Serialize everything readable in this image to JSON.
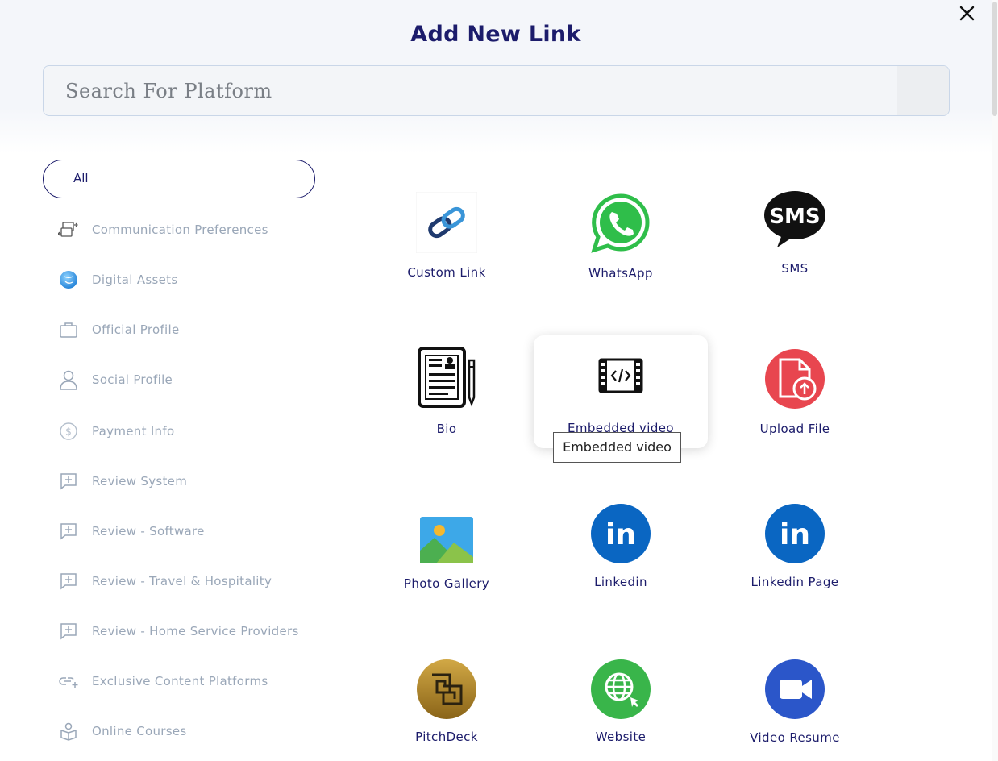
{
  "dialog": {
    "title": "Add New Link",
    "close_label": "close"
  },
  "search": {
    "placeholder": "Search For Platform",
    "value": ""
  },
  "categories": {
    "selected": "All",
    "items": [
      {
        "label": "Communication Preferences",
        "icon": "arrows-exchange-icon"
      },
      {
        "label": "Digital Assets",
        "icon": "globe-icon"
      },
      {
        "label": "Official Profile",
        "icon": "briefcase-icon"
      },
      {
        "label": "Social Profile",
        "icon": "user-icon"
      },
      {
        "label": "Payment Info",
        "icon": "dollar-icon"
      },
      {
        "label": "Review System",
        "icon": "review-icon"
      },
      {
        "label": "Review - Software",
        "icon": "review-icon"
      },
      {
        "label": "Review - Travel & Hospitality",
        "icon": "review-icon"
      },
      {
        "label": "Review - Home Service Providers",
        "icon": "review-icon"
      },
      {
        "label": "Exclusive Content Platforms",
        "icon": "link-add-icon"
      },
      {
        "label": "Online Courses",
        "icon": "book-user-icon"
      }
    ]
  },
  "platforms": [
    {
      "label": "Custom Link",
      "icon": "chain-link-icon"
    },
    {
      "label": "WhatsApp",
      "icon": "whatsapp-icon"
    },
    {
      "label": "SMS",
      "icon": "sms-bubble-icon"
    },
    {
      "label": "Bio",
      "icon": "resume-document-icon"
    },
    {
      "label": "Embedded video",
      "icon": "film-code-icon"
    },
    {
      "label": "Upload File",
      "icon": "upload-file-icon"
    },
    {
      "label": "Photo Gallery",
      "icon": "landscape-photo-icon"
    },
    {
      "label": "Linkedin",
      "icon": "linkedin-icon"
    },
    {
      "label": "Linkedin Page",
      "icon": "linkedin-icon"
    },
    {
      "label": "PitchDeck",
      "icon": "pitchdeck-icon"
    },
    {
      "label": "Website",
      "icon": "globe-click-icon"
    },
    {
      "label": "Video Resume",
      "icon": "video-camera-icon"
    }
  ],
  "tooltip": {
    "text": "Embedded video"
  },
  "colors": {
    "primary": "#1c1c6b",
    "muted": "#9aa7b8",
    "whatsapp": "#2fbe4a",
    "linkedin": "#0a66c2",
    "upload": "#e8464f",
    "website": "#39b54a",
    "video": "#2b56c9",
    "pitchdeck": "#b48a2c"
  }
}
